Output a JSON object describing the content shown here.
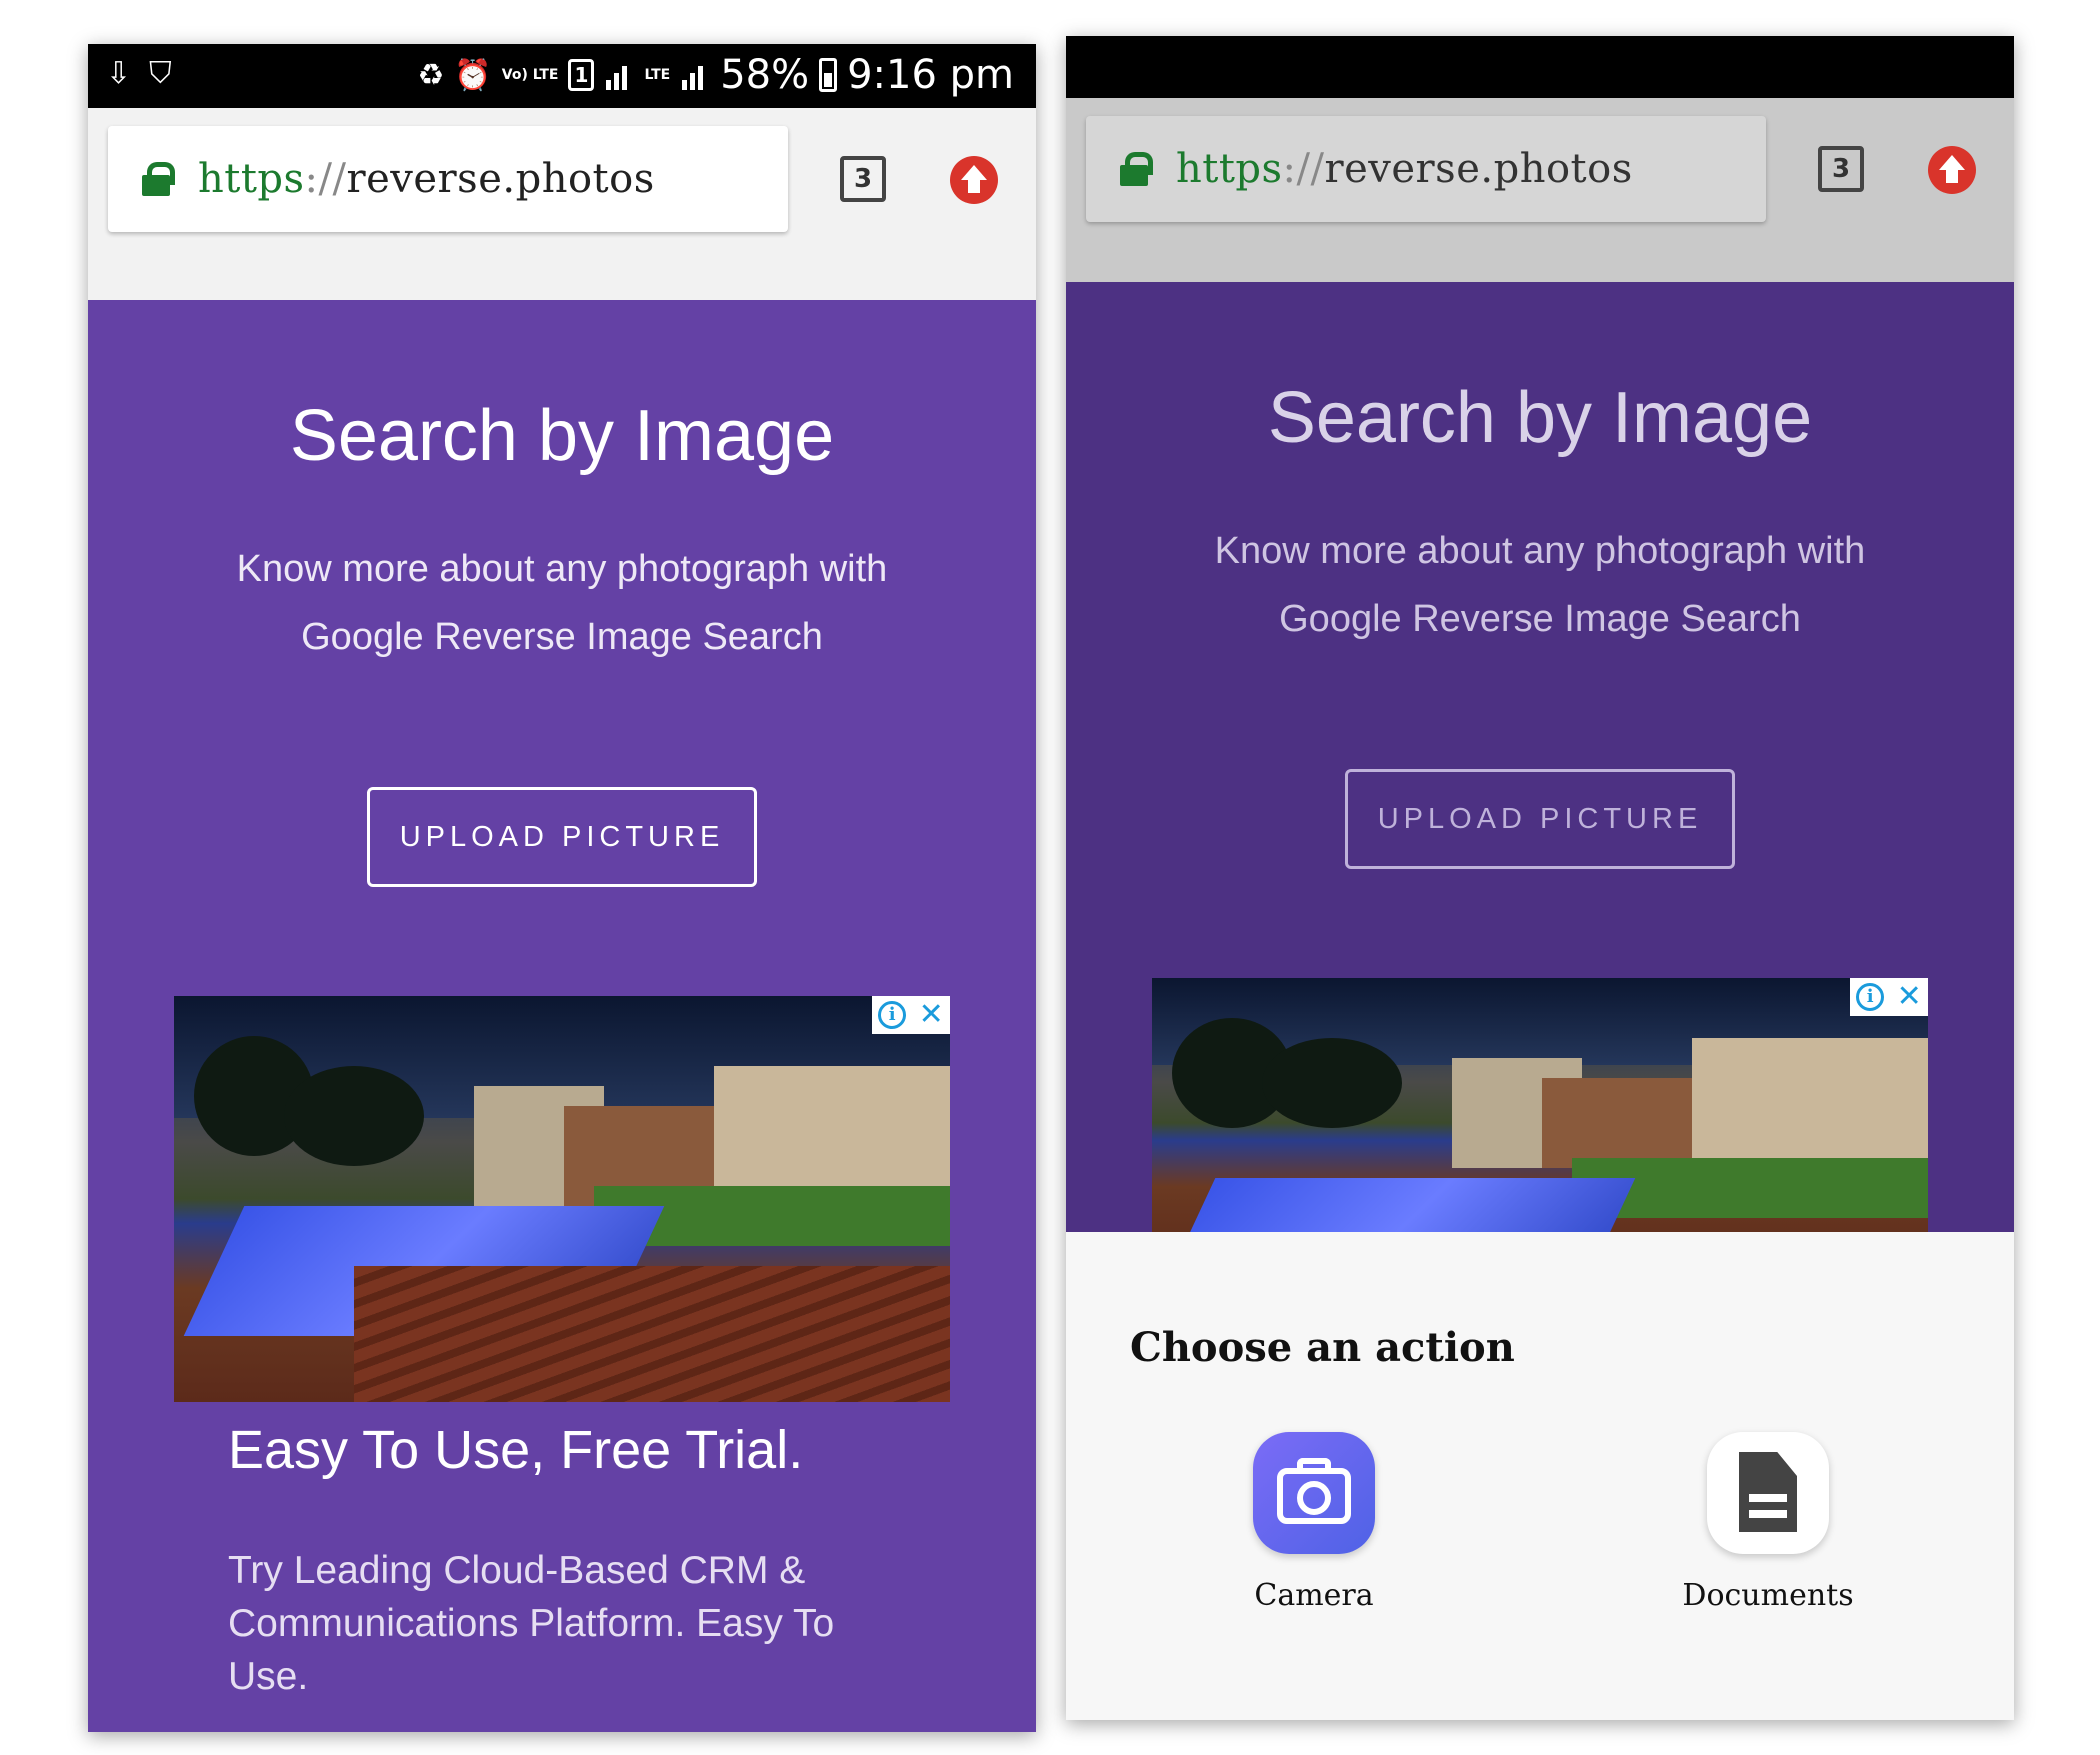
{
  "status_bar": {
    "left_icons": [
      "download-icon",
      "shield-check-icon"
    ],
    "volte": "Vo) LTE",
    "sim": "1",
    "network": "LTE",
    "battery": "58%",
    "time": "9:16 pm"
  },
  "browser": {
    "url_scheme": "https",
    "url_sep": "://",
    "url_host": "reverse.photos",
    "tab_count": "3"
  },
  "hero": {
    "title": "Search by Image",
    "subtitle_line1": "Know more about any photograph with",
    "subtitle_line2": "Google Reverse Image Search",
    "upload_label": "UPLOAD PICTURE"
  },
  "ad": {
    "info_icon": "i",
    "close_icon": "✕",
    "headline": "Easy To Use, Free Trial.",
    "body": "Try Leading Cloud-Based CRM & Communications Platform. Easy To Use."
  },
  "sheet": {
    "title": "Choose an action",
    "actions": [
      {
        "label": "Camera",
        "icon": "camera-icon"
      },
      {
        "label": "Documents",
        "icon": "document-icon"
      }
    ]
  },
  "colors": {
    "hero_bg": "#6441a5",
    "hero_bg_dimmed": "#4d3183",
    "lock_green": "#1c7a2e",
    "upload_red": "#d9342b",
    "ad_badge_blue": "#1a9bdc"
  }
}
